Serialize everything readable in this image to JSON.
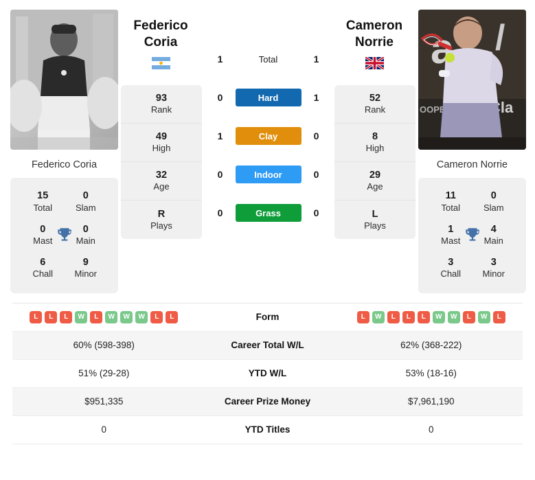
{
  "players": {
    "left": {
      "first_name": "Federico",
      "last_name": "Coria",
      "full_name": "Federico Coria",
      "flag": "argentina-flag",
      "rank": "93",
      "rank_label": "Rank",
      "high": "49",
      "high_label": "High",
      "age": "32",
      "age_label": "Age",
      "plays": "R",
      "plays_label": "Plays",
      "titles": {
        "total": "15",
        "total_label": "Total",
        "slam": "0",
        "slam_label": "Slam",
        "mast": "0",
        "mast_label": "Mast",
        "main": "0",
        "main_label": "Main",
        "chall": "6",
        "chall_label": "Chall",
        "minor": "9",
        "minor_label": "Minor"
      }
    },
    "right": {
      "first_name": "Cameron",
      "last_name": "Norrie",
      "full_name": "Cameron Norrie",
      "flag": "united-kingdom-flag",
      "rank": "52",
      "rank_label": "Rank",
      "high": "8",
      "high_label": "High",
      "age": "29",
      "age_label": "Age",
      "plays": "L",
      "plays_label": "Plays",
      "titles": {
        "total": "11",
        "total_label": "Total",
        "slam": "0",
        "slam_label": "Slam",
        "mast": "1",
        "mast_label": "Mast",
        "main": "4",
        "main_label": "Main",
        "chall": "3",
        "chall_label": "Chall",
        "minor": "3",
        "minor_label": "Minor"
      }
    }
  },
  "head_to_head": [
    {
      "label": "Total",
      "left": "1",
      "right": "1",
      "badge": false,
      "color": ""
    },
    {
      "label": "Hard",
      "left": "0",
      "right": "1",
      "badge": true,
      "color": "#1269b0"
    },
    {
      "label": "Clay",
      "left": "1",
      "right": "0",
      "badge": true,
      "color": "#e08e0b"
    },
    {
      "label": "Indoor",
      "left": "0",
      "right": "0",
      "badge": true,
      "color": "#2e9bf5"
    },
    {
      "label": "Grass",
      "left": "0",
      "right": "0",
      "badge": true,
      "color": "#0f9d3a"
    }
  ],
  "table": {
    "form_label": "Form",
    "form_left": [
      "L",
      "L",
      "L",
      "W",
      "L",
      "W",
      "W",
      "W",
      "L",
      "L"
    ],
    "form_right": [
      "L",
      "W",
      "L",
      "L",
      "L",
      "W",
      "W",
      "L",
      "W",
      "L"
    ],
    "rows": [
      {
        "label": "Career Total W/L",
        "left": "60% (598-398)",
        "right": "62% (368-222)"
      },
      {
        "label": "YTD W/L",
        "left": "51% (29-28)",
        "right": "53% (18-16)"
      },
      {
        "label": "Career Prize Money",
        "left": "$951,335",
        "right": "$7,961,190"
      },
      {
        "label": "YTD Titles",
        "left": "0",
        "right": "0"
      }
    ]
  },
  "colors": {
    "win": "#7ac88a",
    "loss": "#ef5b45",
    "trophy": "#4472a8",
    "card_bg": "#f0f0f0"
  }
}
